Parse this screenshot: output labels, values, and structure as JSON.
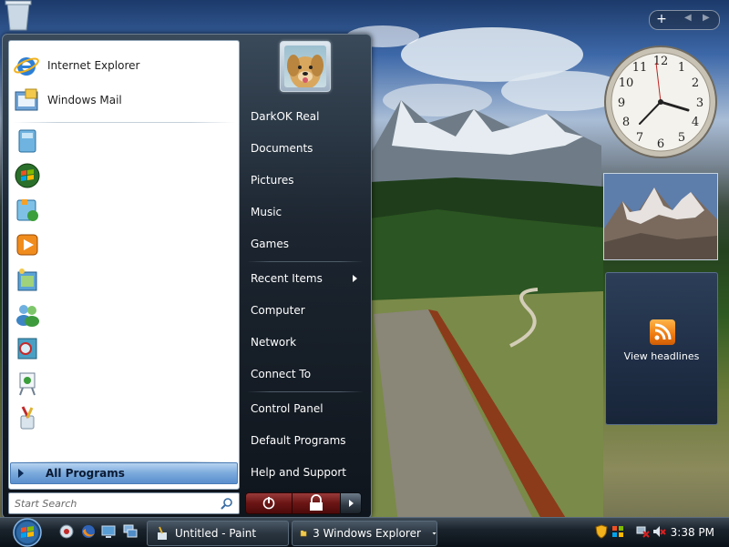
{
  "start_menu": {
    "pinned": [
      {
        "label": "Internet Explorer"
      },
      {
        "label": "Windows Mail"
      }
    ],
    "all_programs_label": "All Programs",
    "search_placeholder": "Start Search",
    "right_items": [
      {
        "label": "DarkOK Real"
      },
      {
        "label": "Documents"
      },
      {
        "label": "Pictures"
      },
      {
        "label": "Music"
      },
      {
        "label": "Games"
      },
      {
        "label": "Recent Items"
      },
      {
        "label": "Computer"
      },
      {
        "label": "Network"
      },
      {
        "label": "Connect To"
      },
      {
        "label": "Control Panel"
      },
      {
        "label": "Default Programs"
      },
      {
        "label": "Help and Support"
      }
    ]
  },
  "sidebar": {
    "add_glyph": "+",
    "feed_label": "View headlines"
  },
  "taskbar": {
    "tasks": [
      {
        "label": "Untitled - Paint"
      },
      {
        "label": "3 Windows Explorer"
      }
    ],
    "time": "3:38 PM"
  },
  "colors": {
    "all_programs_bg": "#7aa9dc",
    "power_button": "#6a1414",
    "rss_orange": "#ee7a10"
  }
}
